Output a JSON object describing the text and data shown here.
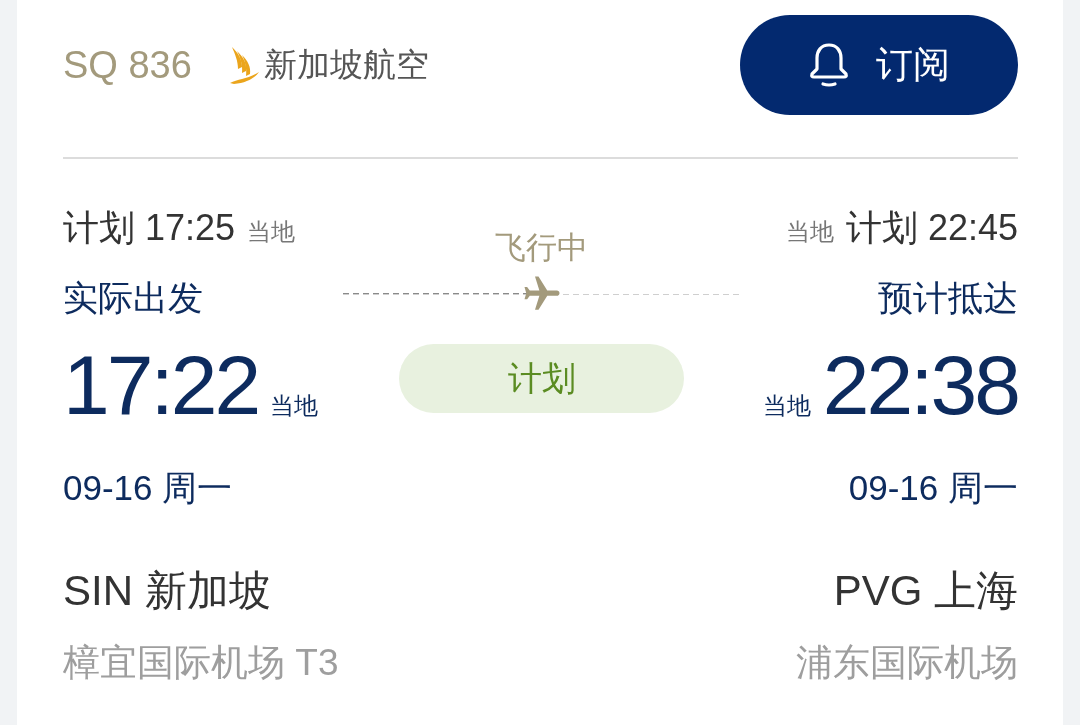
{
  "flight": {
    "number": "SQ 836",
    "airline": "新加坡航空"
  },
  "subscribe_button": {
    "label": "订阅"
  },
  "departure": {
    "scheduled": "计划 17:25",
    "scheduled_zone": "当地",
    "status": "实际出发",
    "time": "17:22",
    "time_zone": "当地",
    "date": "09-16 周一",
    "city": "SIN 新加坡",
    "airport": "樟宜国际机场 T3"
  },
  "progress": {
    "status": "飞行中",
    "level": 0.5,
    "badge": "计划"
  },
  "arrival": {
    "scheduled": "计划 22:45",
    "scheduled_zone": "当地",
    "status": "预计抵达",
    "time": "22:38",
    "time_zone": "当地",
    "date": "09-16 周一",
    "city": "PVG 上海",
    "airport": "浦东国际机场"
  }
}
